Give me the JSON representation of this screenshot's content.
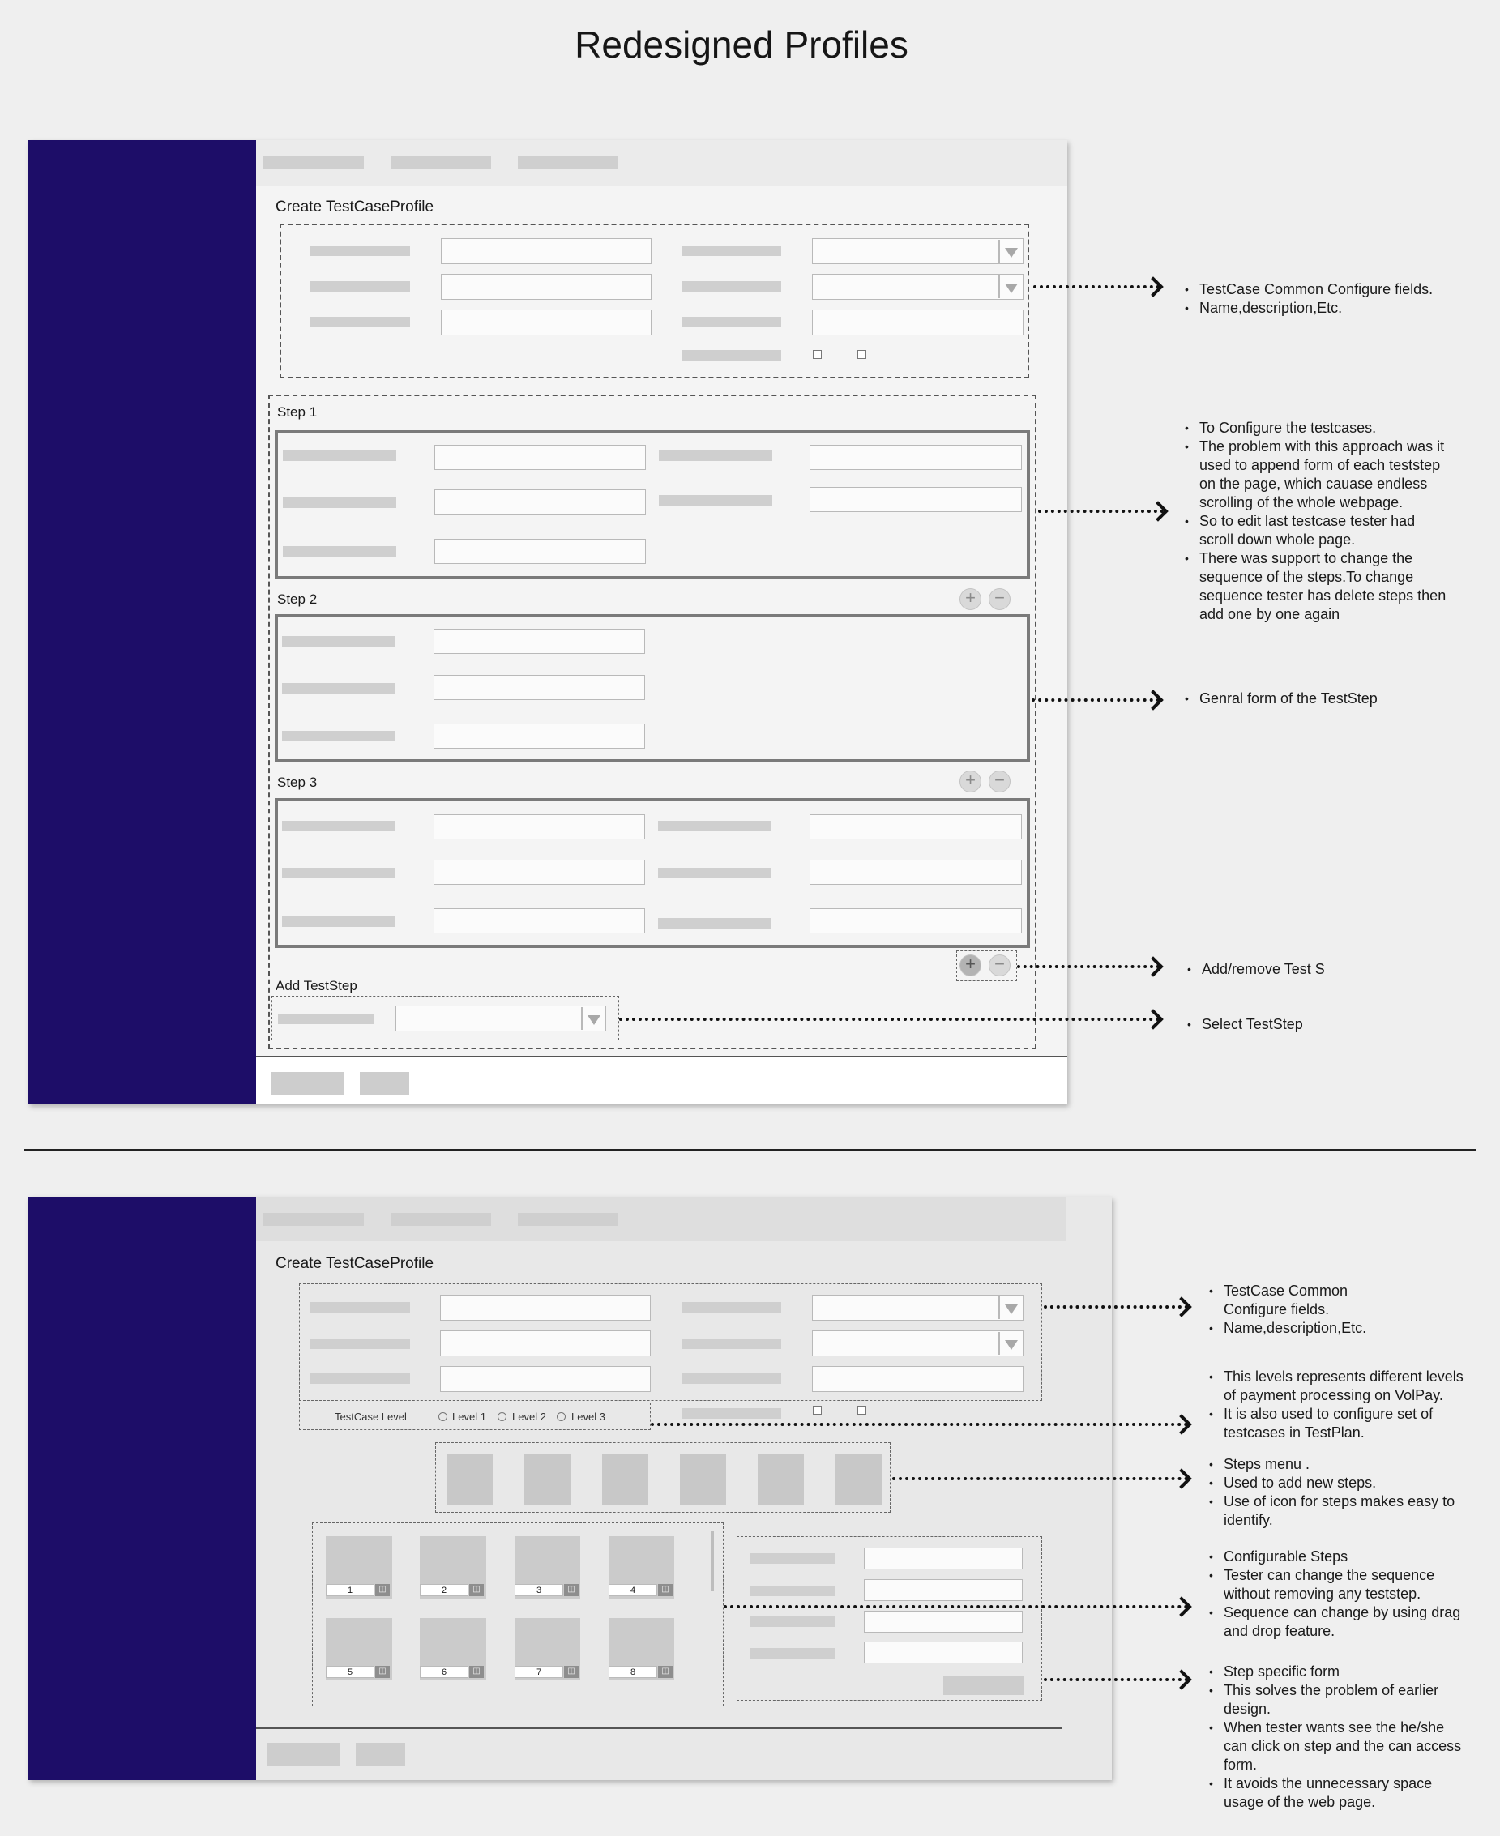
{
  "page_title": "Redesigned Profiles",
  "top": {
    "form_title": "Create TestCaseProfile",
    "step_labels": [
      "Step 1",
      "Step 2",
      "Step 3"
    ],
    "add_teststep_label": "Add TestStep",
    "notes": {
      "common": [
        "TestCase Common Configure fields.",
        "Name,description,Etc."
      ],
      "configure": [
        "To Configure the testcases.",
        "The problem with this approach was it used to append form of each teststep on the page, which cauase endless scrolling of the whole webpage.",
        "So to edit last testcase tester had scroll down whole page.",
        "There was support to change the sequence of the steps.To change sequence  tester has delete steps then add one by one again"
      ],
      "general": [
        "Genral form of the TestStep"
      ],
      "addremove": [
        "Add/remove Test S"
      ],
      "select": [
        "Select TestStep"
      ]
    }
  },
  "bottom": {
    "form_title": "Create TestCaseProfile",
    "level_label": "TestCase Level",
    "levels": [
      "Level 1",
      "Level 2",
      "Level 3"
    ],
    "cards": [
      "1",
      "2",
      "3",
      "4",
      "5",
      "6",
      "7",
      "8"
    ],
    "notes": {
      "common": [
        "TestCase Common Configure fields.",
        "Name,description,Etc."
      ],
      "levels": [
        "This levels represents different levels of payment processing on VolPay.",
        "It is also used to configure  set of testcases in TestPlan."
      ],
      "menu": [
        "Steps menu .",
        "Used to add new steps.",
        "Use of icon for steps makes easy to identify."
      ],
      "configurable": [
        "Configurable Steps",
        "Tester can change the sequence without removing any teststep.",
        "Sequence can change by using drag and drop feature."
      ],
      "specific": [
        "Step specific form",
        "This solves the problem of earlier design.",
        "When tester wants see the he/she can click on step and the can access form.",
        "It avoids the unnecessary space usage of the web page."
      ]
    }
  },
  "icons": {
    "add": "plus-icon",
    "remove": "minus-icon",
    "delete": "trash-icon",
    "dropdown": "chevron-down-icon"
  },
  "colors": {
    "sidebar": "#1d0d68",
    "background": "#efefef"
  }
}
